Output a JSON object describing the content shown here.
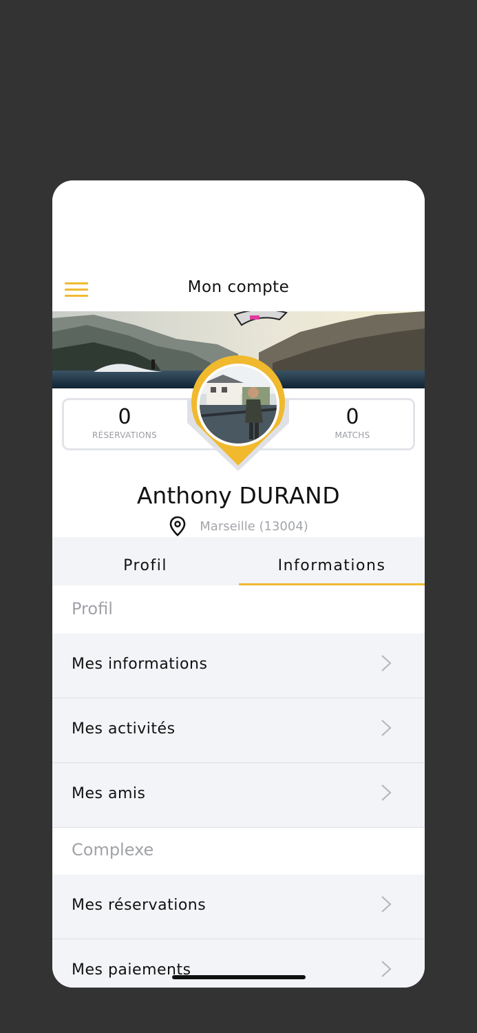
{
  "header": {
    "title": "Mon compte",
    "menu_icon": "hamburger-menu-icon"
  },
  "stats": {
    "reservations": {
      "value": "0",
      "label": "RÉSERVATIONS"
    },
    "matchs": {
      "value": "0",
      "label": "MATCHS"
    }
  },
  "user": {
    "first_name": "Anthony",
    "last_name": "DURAND",
    "location": "Marseille (13004)"
  },
  "tabs": [
    {
      "label": "Profil",
      "active": false
    },
    {
      "label": "Informations",
      "active": true
    }
  ],
  "sections": [
    {
      "title": "Profil",
      "items": [
        "Mes informations",
        "Mes activités",
        "Mes amis"
      ]
    },
    {
      "title": "Complexe",
      "items": [
        "Mes réservations",
        "Mes paiements"
      ]
    }
  ],
  "colors": {
    "accent": "#f0b92e",
    "list_bg": "#f3f4f7",
    "background": "#333333"
  }
}
